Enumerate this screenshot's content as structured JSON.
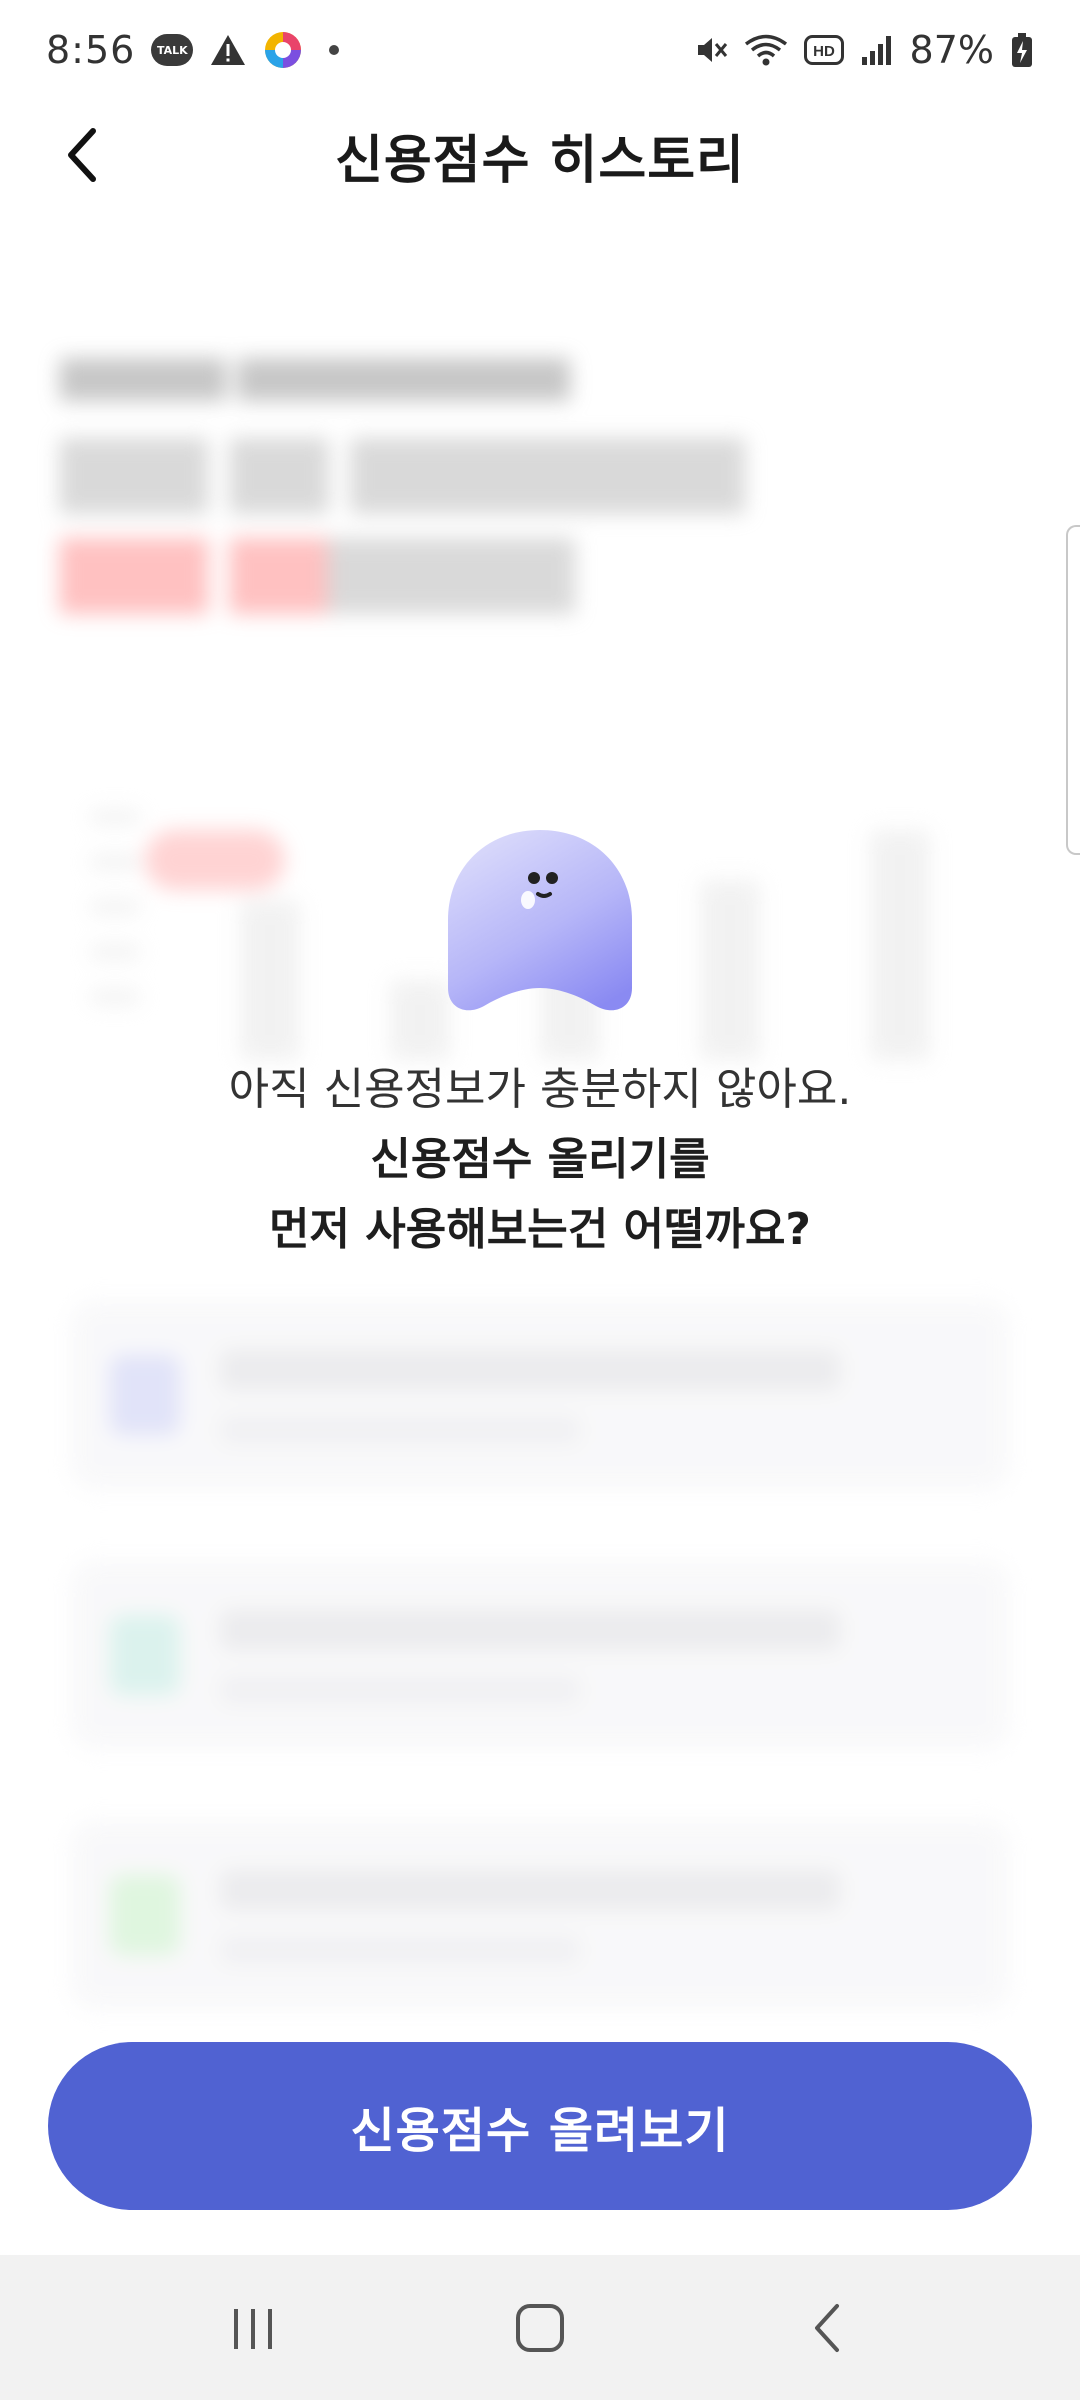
{
  "status_bar": {
    "time": "8:56",
    "talk_label": "TALK",
    "battery_percent": "87%",
    "icons": [
      "kakaotalk-icon",
      "warning-icon",
      "app-icon",
      "mute-icon",
      "wifi-icon",
      "hd-icon",
      "signal-icon",
      "battery-charging-icon"
    ]
  },
  "header": {
    "title": "신용점수 히스토리",
    "back_icon": "chevron-left-icon"
  },
  "message": {
    "line1": "아직 신용정보가 충분하지 않아요.",
    "line2": "신용점수 올리기를",
    "line3": "먼저 사용해보는건 어떨까요?"
  },
  "cta": {
    "label": "신용점수 올려보기",
    "color": "#5062d2"
  },
  "nav_bar": {
    "items": [
      "recent-apps-icon",
      "home-icon",
      "back-icon"
    ]
  },
  "colors": {
    "mascot_light": "#d6d6fb",
    "mascot_dark": "#8e8ef5",
    "accent": "#5062d2"
  }
}
